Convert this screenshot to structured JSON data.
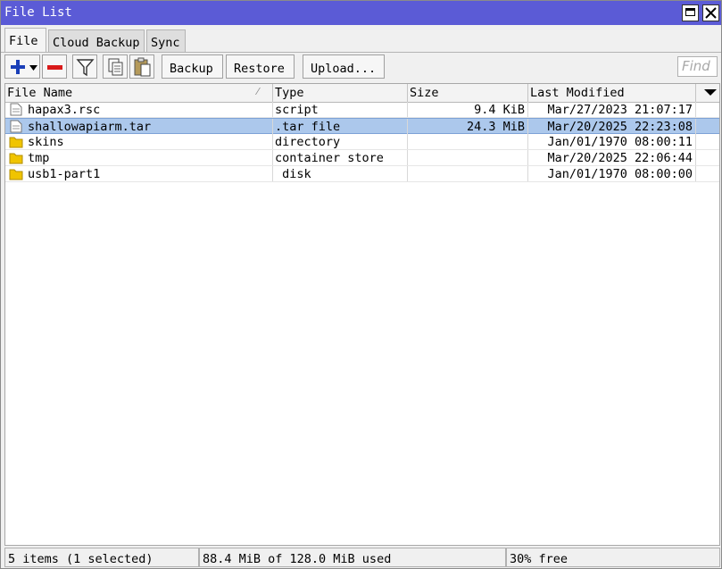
{
  "window": {
    "title": "File List",
    "titlebar_color": "#5b5bd6",
    "selection_color": "#acc8ec"
  },
  "tabs": [
    {
      "label": "File",
      "active": true
    },
    {
      "label": "Cloud Backup",
      "active": false
    },
    {
      "label": "Sync",
      "active": false
    }
  ],
  "toolbar": {
    "add_icon": "plus-icon",
    "dropdown_icon": "chevron-down-icon",
    "remove_icon": "minus-icon",
    "filter_icon": "filter-icon",
    "copy_icon": "copy-icon",
    "paste_icon": "paste-icon",
    "backup_label": "Backup",
    "restore_label": "Restore",
    "upload_label": "Upload...",
    "find_placeholder": "Find"
  },
  "table": {
    "columns": [
      "File Name",
      "Type",
      "Size",
      "Last Modified"
    ],
    "rows": [
      {
        "icon": "file-icon",
        "name": "hapax3.rsc",
        "type": "script",
        "size": "9.4 KiB",
        "modified": "Mar/27/2023 21:07:17",
        "selected": false
      },
      {
        "icon": "file-icon",
        "name": "shallowapiarm.tar",
        "type": ".tar file",
        "size": "24.3 MiB",
        "modified": "Mar/20/2025 22:23:08",
        "selected": true
      },
      {
        "icon": "folder-icon",
        "name": "skins",
        "type": "directory",
        "size": "",
        "modified": "Jan/01/1970 08:00:11",
        "selected": false
      },
      {
        "icon": "folder-icon",
        "name": "tmp",
        "type": "container store",
        "size": "",
        "modified": "Mar/20/2025 22:06:44",
        "selected": false
      },
      {
        "icon": "folder-icon",
        "name": "usb1-part1",
        "type": " disk",
        "size": "",
        "modified": "Jan/01/1970 08:00:00",
        "selected": false
      }
    ]
  },
  "status": {
    "items": "5 items (1 selected)",
    "usage": "88.4 MiB of 128.0 MiB used",
    "free": "30% free"
  }
}
